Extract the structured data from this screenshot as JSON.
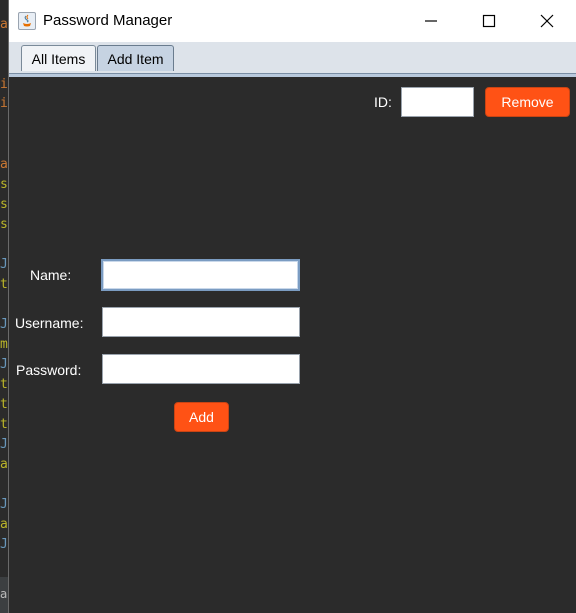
{
  "window": {
    "title": "Password Manager"
  },
  "background_ide": {
    "lines": [
      {
        "text": "a",
        "color": "#cc7832"
      },
      {
        "text": "i",
        "color": "#cc7832"
      },
      {
        "text": "i",
        "color": "#cc7832"
      },
      {
        "text": "a",
        "color": "#cc7832"
      },
      {
        "text": "s",
        "color": "#bbb529"
      },
      {
        "text": "s",
        "color": "#bbb529"
      },
      {
        "text": "s",
        "color": "#bbb529"
      },
      {
        "text": "J",
        "color": "#6897bb"
      },
      {
        "text": "t",
        "color": "#bbb529"
      },
      {
        "text": "J",
        "color": "#6897bb"
      },
      {
        "text": "m",
        "color": "#bbb529"
      },
      {
        "text": "J",
        "color": "#6897bb"
      },
      {
        "text": "t",
        "color": "#bbb529"
      },
      {
        "text": "t",
        "color": "#bbb529"
      },
      {
        "text": "t",
        "color": "#bbb529"
      },
      {
        "text": "J",
        "color": "#6897bb"
      },
      {
        "text": "a",
        "color": "#bbb529"
      },
      {
        "text": "J",
        "color": "#6897bb"
      },
      {
        "text": "a",
        "color": "#bbb529"
      },
      {
        "text": "J",
        "color": "#6897bb"
      }
    ],
    "bottom_text": "a"
  },
  "tabs": [
    {
      "label": "All Items",
      "active": false
    },
    {
      "label": "Add Item",
      "active": true
    }
  ],
  "remove_section": {
    "id_label": "ID:",
    "id_value": "",
    "remove_button": "Remove"
  },
  "form": {
    "name_label": "Name:",
    "name_value": "",
    "username_label": "Username:",
    "username_value": "",
    "password_label": "Password:",
    "password_value": "",
    "add_button": "Add"
  },
  "colors": {
    "accent_button": "#ff5215",
    "panel_background": "#2b2b2b"
  }
}
